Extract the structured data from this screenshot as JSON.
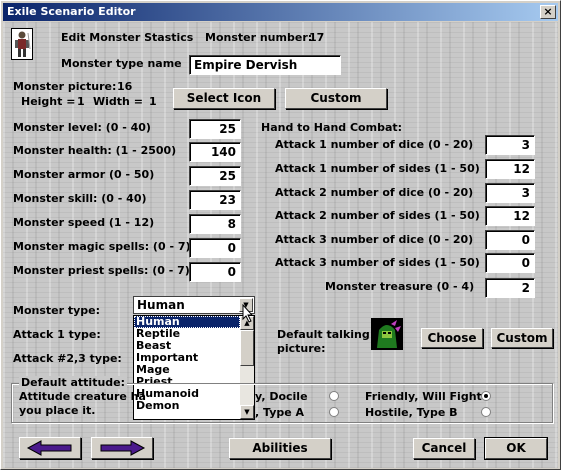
{
  "window": {
    "title": "Exile Scenario Editor",
    "close_label": "×"
  },
  "header": {
    "title": "Edit Monster Stastics",
    "number_label": "Monster number:",
    "number_value": "17"
  },
  "name": {
    "label": "Monster type name",
    "value": "Empire Dervish"
  },
  "picture": {
    "label": "Monster picture:",
    "value": "16",
    "height_label": "Height =",
    "height_value": "1",
    "width_label": "Width =",
    "width_value": "1",
    "select_icon": "Select Icon",
    "custom": "Custom"
  },
  "stats": [
    {
      "label": "Monster level: (0 - 40)",
      "value": "25"
    },
    {
      "label": "Monster health: (1 - 2500)",
      "value": "140"
    },
    {
      "label": "Monster armor (0 - 50)",
      "value": "25"
    },
    {
      "label": "Monster skill: (0 - 40)",
      "value": "23"
    },
    {
      "label": "Monster speed (1 - 12)",
      "value": "8"
    },
    {
      "label": "Monster magic spells: (0 - 7)",
      "value": "0"
    },
    {
      "label": "Monster priest spells: (0 - 7)",
      "value": "0"
    }
  ],
  "combat": {
    "title": "Hand to Hand Combat:",
    "rows": [
      {
        "label": "Attack 1 number of dice (0 - 20)",
        "value": "3"
      },
      {
        "label": "Attack 1 number of sides (1 - 50)",
        "value": "12"
      },
      {
        "label": "Attack 2 number of dice (0 - 20)",
        "value": "3"
      },
      {
        "label": "Attack 2 number of sides (1 - 50)",
        "value": "12"
      },
      {
        "label": "Attack 3 number of dice (0 - 20)",
        "value": "0"
      },
      {
        "label": "Attack 3 number of sides (1 - 50)",
        "value": "0"
      }
    ],
    "treasure_label": "Monster treasure (0 - 4)",
    "treasure_value": "2"
  },
  "type": {
    "label": "Monster type:",
    "selected": "Human",
    "options": [
      "Human",
      "Reptile",
      "Beast",
      "Important",
      "Mage",
      "Priest",
      "Humanoid",
      "Demon"
    ]
  },
  "attack1_label": "Attack 1 type:",
  "attack23_label": "Attack #2,3 type:",
  "talking": {
    "label_line1": "Default talking",
    "label_line2": "picture:",
    "choose": "Choose",
    "custom": "Custom"
  },
  "attitude": {
    "title": "Default attitude:",
    "desc_line1": "Attitude creature ha",
    "desc_line2": "you place it.",
    "options": [
      {
        "label": "y, Docile",
        "checked": false
      },
      {
        "label": "Friendly, Will Fight",
        "checked": true
      },
      {
        "label": ", Type A",
        "checked": false
      },
      {
        "label": "Hostile, Type B",
        "checked": false
      }
    ]
  },
  "footer": {
    "abilities": "Abilities",
    "cancel": "Cancel",
    "ok": "OK"
  },
  "colors": {
    "arrow": "#4b1a8c",
    "titlebar": "#0a246a",
    "selection": "#0a246a"
  }
}
